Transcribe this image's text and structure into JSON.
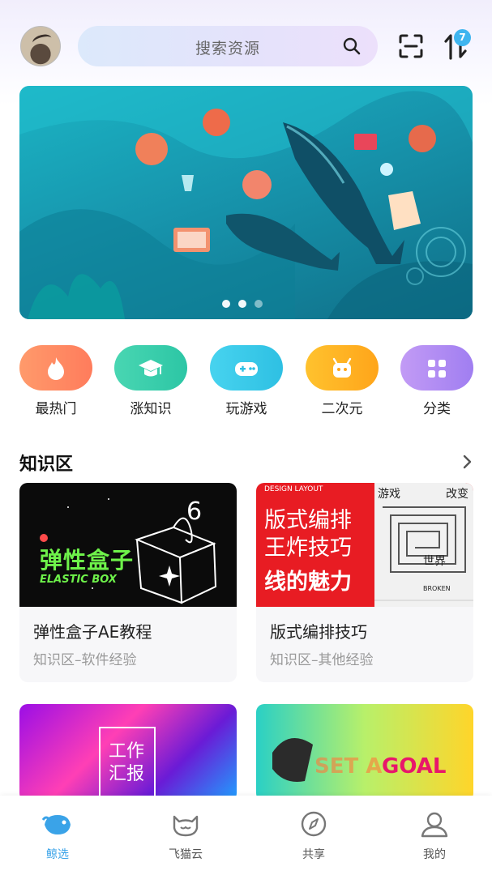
{
  "search": {
    "placeholder": "搜索资源"
  },
  "notifications": {
    "badge_count": "7"
  },
  "banner": {
    "pager": {
      "count": 3,
      "active": 1
    }
  },
  "categories": [
    {
      "label": "最热门",
      "color_from": "#ff9a6b",
      "color_to": "#ff7c5c",
      "icon": "flame-icon"
    },
    {
      "label": "涨知识",
      "color_from": "#49d6b2",
      "color_to": "#2cc6a5",
      "icon": "graduation-cap-icon"
    },
    {
      "label": "玩游戏",
      "color_from": "#47d3ef",
      "color_to": "#2ec0e3",
      "icon": "gamepad-icon"
    },
    {
      "label": "二次元",
      "color_from": "#ffc22e",
      "color_to": "#ffa51a",
      "icon": "android-icon"
    },
    {
      "label": "分类",
      "color_from": "#c29bf5",
      "color_to": "#a07ef1",
      "icon": "grid-icon"
    }
  ],
  "knowledge": {
    "title": "知识区",
    "cards": [
      {
        "title": "弹性盒子AE教程",
        "subtitle": "知识区–软件经验",
        "thumb_text_cn": "弹性盒子",
        "thumb_text_en": "ELASTIC BOX"
      },
      {
        "title": "版式编排技巧",
        "subtitle": "知识区–其他经验",
        "thumb_tag": "DESIGN LAYOUT",
        "thumb_line1": "版式编排",
        "thumb_line2": "王炸技巧",
        "thumb_line3": "线的魅力",
        "maze_text_1": "游戏",
        "maze_text_2": "改变",
        "maze_text_3": "世界",
        "maze_text_4": "BROKEN"
      }
    ],
    "more_cards": [
      {
        "thumb_text": "工作\n汇报",
        "thumb_line1": "工作",
        "thumb_line2": "汇报"
      },
      {
        "thumb_text_a": "SET A",
        "thumb_text_b": "GOAL"
      }
    ]
  },
  "tabbar": [
    {
      "label": "鲸选",
      "active": true,
      "icon": "whale-icon"
    },
    {
      "label": "飞猫云",
      "active": false,
      "icon": "cat-icon"
    },
    {
      "label": "共享",
      "active": false,
      "icon": "compass-icon"
    },
    {
      "label": "我的",
      "active": false,
      "icon": "user-icon"
    }
  ],
  "colors": {
    "accent": "#3aa3e8",
    "banner_bg": "#1795ad"
  }
}
